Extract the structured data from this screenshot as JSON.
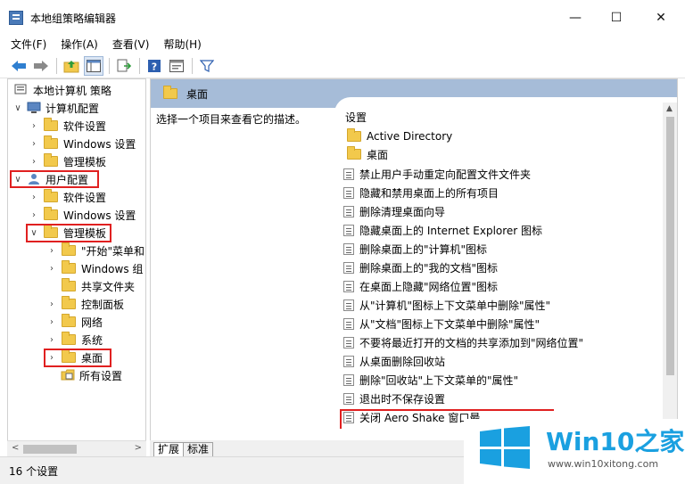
{
  "window": {
    "title": "本地组策略编辑器",
    "min": "—",
    "max": "☐",
    "close": "✕"
  },
  "menu": [
    "文件(F)",
    "操作(A)",
    "查看(V)",
    "帮助(H)"
  ],
  "tree": {
    "root": "本地计算机 策略",
    "computer_config": "计算机配置",
    "cc_software": "软件设置",
    "cc_windows": "Windows 设置",
    "cc_admin": "管理模板",
    "user_config": "用户配置",
    "uc_software": "软件设置",
    "uc_windows": "Windows 设置",
    "uc_admin": "管理模板",
    "start_menu": "\"开始\"菜单和",
    "windows_components": "Windows 组",
    "shared_folders": "共享文件夹",
    "control_panel": "控制面板",
    "network": "网络",
    "system": "系统",
    "desktop": "桌面",
    "all_settings": "所有设置"
  },
  "right_pane": {
    "header": "桌面",
    "description": "选择一个项目来查看它的描述。",
    "column": "设置",
    "items": [
      {
        "label": "Active Directory",
        "type": "folder"
      },
      {
        "label": "桌面",
        "type": "folder"
      },
      {
        "label": "禁止用户手动重定向配置文件文件夹",
        "type": "policy"
      },
      {
        "label": "隐藏和禁用桌面上的所有项目",
        "type": "policy"
      },
      {
        "label": "删除清理桌面向导",
        "type": "policy"
      },
      {
        "label": "隐藏桌面上的 Internet Explorer 图标",
        "type": "policy"
      },
      {
        "label": "删除桌面上的\"计算机\"图标",
        "type": "policy"
      },
      {
        "label": "删除桌面上的\"我的文档\"图标",
        "type": "policy"
      },
      {
        "label": "在桌面上隐藏\"网络位置\"图标",
        "type": "policy"
      },
      {
        "label": "从\"计算机\"图标上下文菜单中删除\"属性\"",
        "type": "policy"
      },
      {
        "label": "从\"文档\"图标上下文菜单中删除\"属性\"",
        "type": "policy"
      },
      {
        "label": "不要将最近打开的文档的共享添加到\"网络位置\"",
        "type": "policy"
      },
      {
        "label": "从桌面删除回收站",
        "type": "policy"
      },
      {
        "label": "删除\"回收站\"上下文菜单的\"属性\"",
        "type": "policy"
      },
      {
        "label": "退出时不保存设置",
        "type": "policy"
      },
      {
        "label": "关闭 Aero Shake 窗口最",
        "type": "policy"
      }
    ]
  },
  "tabs": [
    "扩展",
    "标准"
  ],
  "status": "16 个设置",
  "watermark": {
    "brand": "Win10",
    "brand_cn": "之家",
    "url": "www.win10xitong.com"
  },
  "colors": {
    "accent": "#1aa0e0",
    "header": "#a6bcd8",
    "highlight": "#e02020"
  }
}
